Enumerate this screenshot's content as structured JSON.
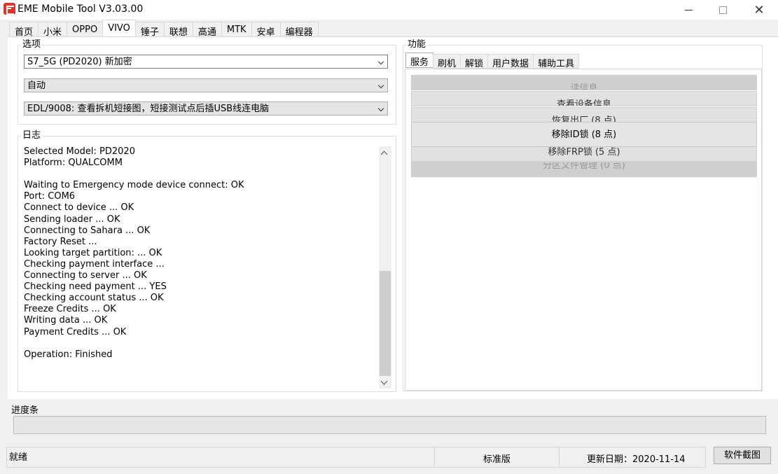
{
  "window": {
    "title": "EME Mobile Tool V3.03.00"
  },
  "main_tabs": [
    "首页",
    "小米",
    "OPPO",
    "VIVO",
    "锤子",
    "联想",
    "高通",
    "MTK",
    "安卓",
    "编程器"
  ],
  "main_tabs_active": "VIVO",
  "options": {
    "title": "选项",
    "model_select": "S7_5G (PD2020) 新加密",
    "mode_select": "自动",
    "edl_select": "EDL/9008: 查看拆机短接图，短接测试点后插USB线连电脑"
  },
  "log": {
    "title": "日志",
    "lines": [
      "Selected Model: PD2020",
      "Platform: QUALCOMM",
      "",
      "Waiting to Emergency mode device connect: OK",
      "Port: COM6",
      "Connect to device ... OK",
      "Sending loader ... OK",
      "Connecting to Sahara ... OK",
      "Factory Reset ...",
      "Looking target partition: ... OK",
      "Checking payment interface ...",
      "Connecting to server ... OK",
      "Checking need payment ... YES",
      "Checking account status ... OK",
      "Freeze Credits ... OK",
      "Writing data ... OK",
      "Payment Credits ... OK",
      "",
      "Operation: Finished"
    ]
  },
  "functions": {
    "title": "功能",
    "tabs": [
      "服务",
      "刷机",
      "解锁",
      "用户数据",
      "辅助工具"
    ],
    "active_tab": "服务",
    "buttons": {
      "read_info": "读信息",
      "view_device_info": "查看设备信息",
      "factory_reset": "恢复出厂 (8 点)",
      "remove_id_lock": "移除ID锁 (8 点)",
      "remove_frp_lock": "移除FRP锁 (5 点)",
      "partition_manager": "分区文件管理 (0 点)"
    }
  },
  "progress": {
    "label": "进度条",
    "value": 0
  },
  "status_bar": {
    "status": "就绪",
    "edition": "标准版",
    "update_date": "更新日期：2020-11-14",
    "screenshot_button": "软件截图"
  }
}
